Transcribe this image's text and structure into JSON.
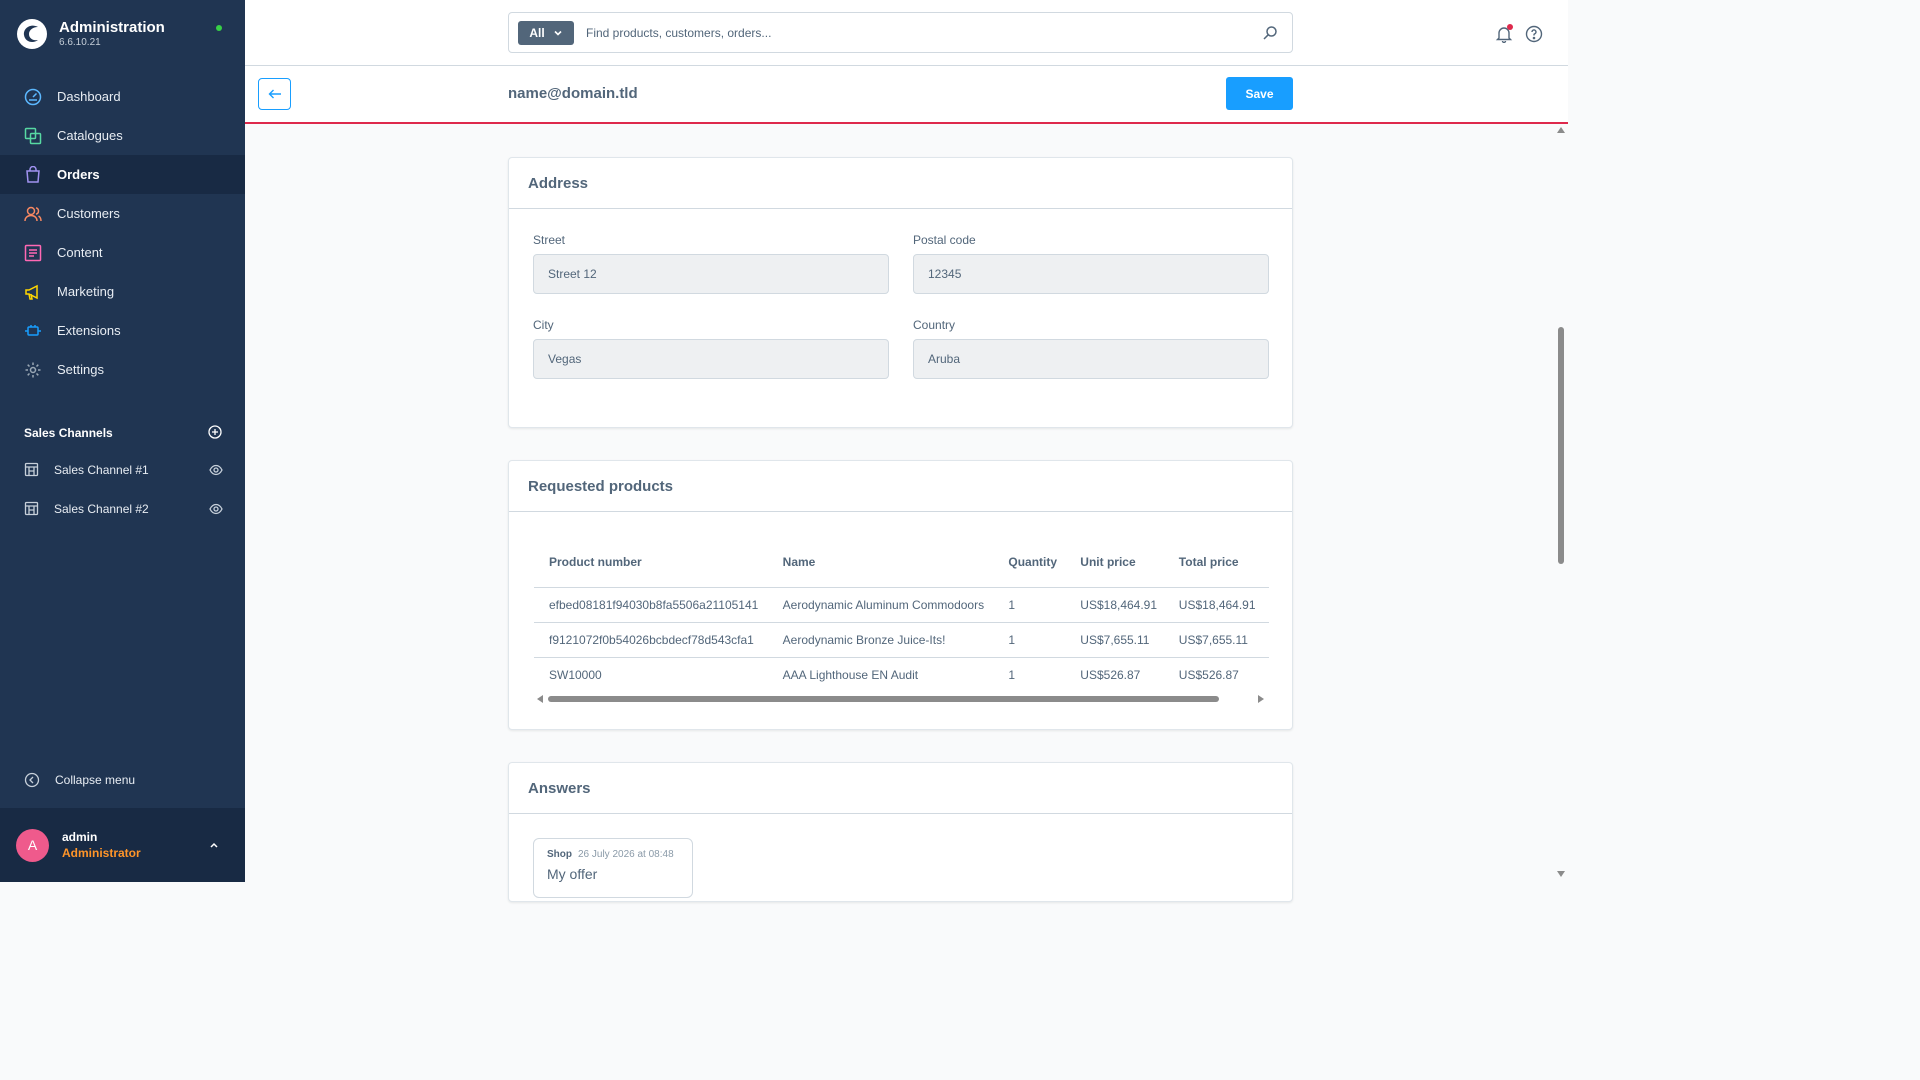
{
  "brand": {
    "title": "Administration",
    "version": "6.6.10.21"
  },
  "nav": {
    "items": [
      {
        "label": "Dashboard",
        "icon": "dashboard-icon"
      },
      {
        "label": "Catalogues",
        "icon": "catalogues-icon"
      },
      {
        "label": "Orders",
        "icon": "orders-icon",
        "active": true
      },
      {
        "label": "Customers",
        "icon": "customers-icon"
      },
      {
        "label": "Content",
        "icon": "content-icon"
      },
      {
        "label": "Marketing",
        "icon": "marketing-icon"
      },
      {
        "label": "Extensions",
        "icon": "extensions-icon"
      },
      {
        "label": "Settings",
        "icon": "settings-icon"
      }
    ]
  },
  "sales_channels": {
    "title": "Sales Channels",
    "items": [
      {
        "label": "Sales Channel #1"
      },
      {
        "label": "Sales Channel #2"
      }
    ]
  },
  "collapse_label": "Collapse menu",
  "user": {
    "initial": "A",
    "name": "admin",
    "role": "Administrator"
  },
  "search": {
    "type_label": "All",
    "placeholder": "Find products, customers, orders..."
  },
  "smartbar": {
    "title": "name@domain.tld",
    "save_label": "Save"
  },
  "address": {
    "title": "Address",
    "street_label": "Street",
    "street_value": "Street 12",
    "postal_label": "Postal code",
    "postal_value": "12345",
    "city_label": "City",
    "city_value": "Vegas",
    "country_label": "Country",
    "country_value": "Aruba"
  },
  "products": {
    "title": "Requested products",
    "columns": [
      "Product number",
      "Name",
      "Quantity",
      "Unit price",
      "Total price"
    ],
    "rows": [
      [
        "efbed08181f94030b8fa5506a21105141",
        "Aerodynamic Aluminum Commodoors",
        "1",
        "US$18,464.91",
        "US$18,464.91"
      ],
      [
        "f9121072f0b54026bcbdecf78d543cfa1",
        "Aerodynamic Bronze Juice-Its!",
        "1",
        "US$7,655.11",
        "US$7,655.11"
      ],
      [
        "SW10000",
        "AAA Lighthouse EN Audit",
        "1",
        "US$526.87",
        "US$526.87"
      ]
    ]
  },
  "answers": {
    "title": "Answers",
    "items": [
      {
        "author": "Shop",
        "date": "26 July 2026 at 08:48",
        "text": "My offer"
      }
    ]
  },
  "colors": {
    "sidebar": "#203552",
    "accent": "#189eff",
    "alert": "#de294c",
    "role": "#ff9529",
    "avatar": "#ef5a8c"
  }
}
